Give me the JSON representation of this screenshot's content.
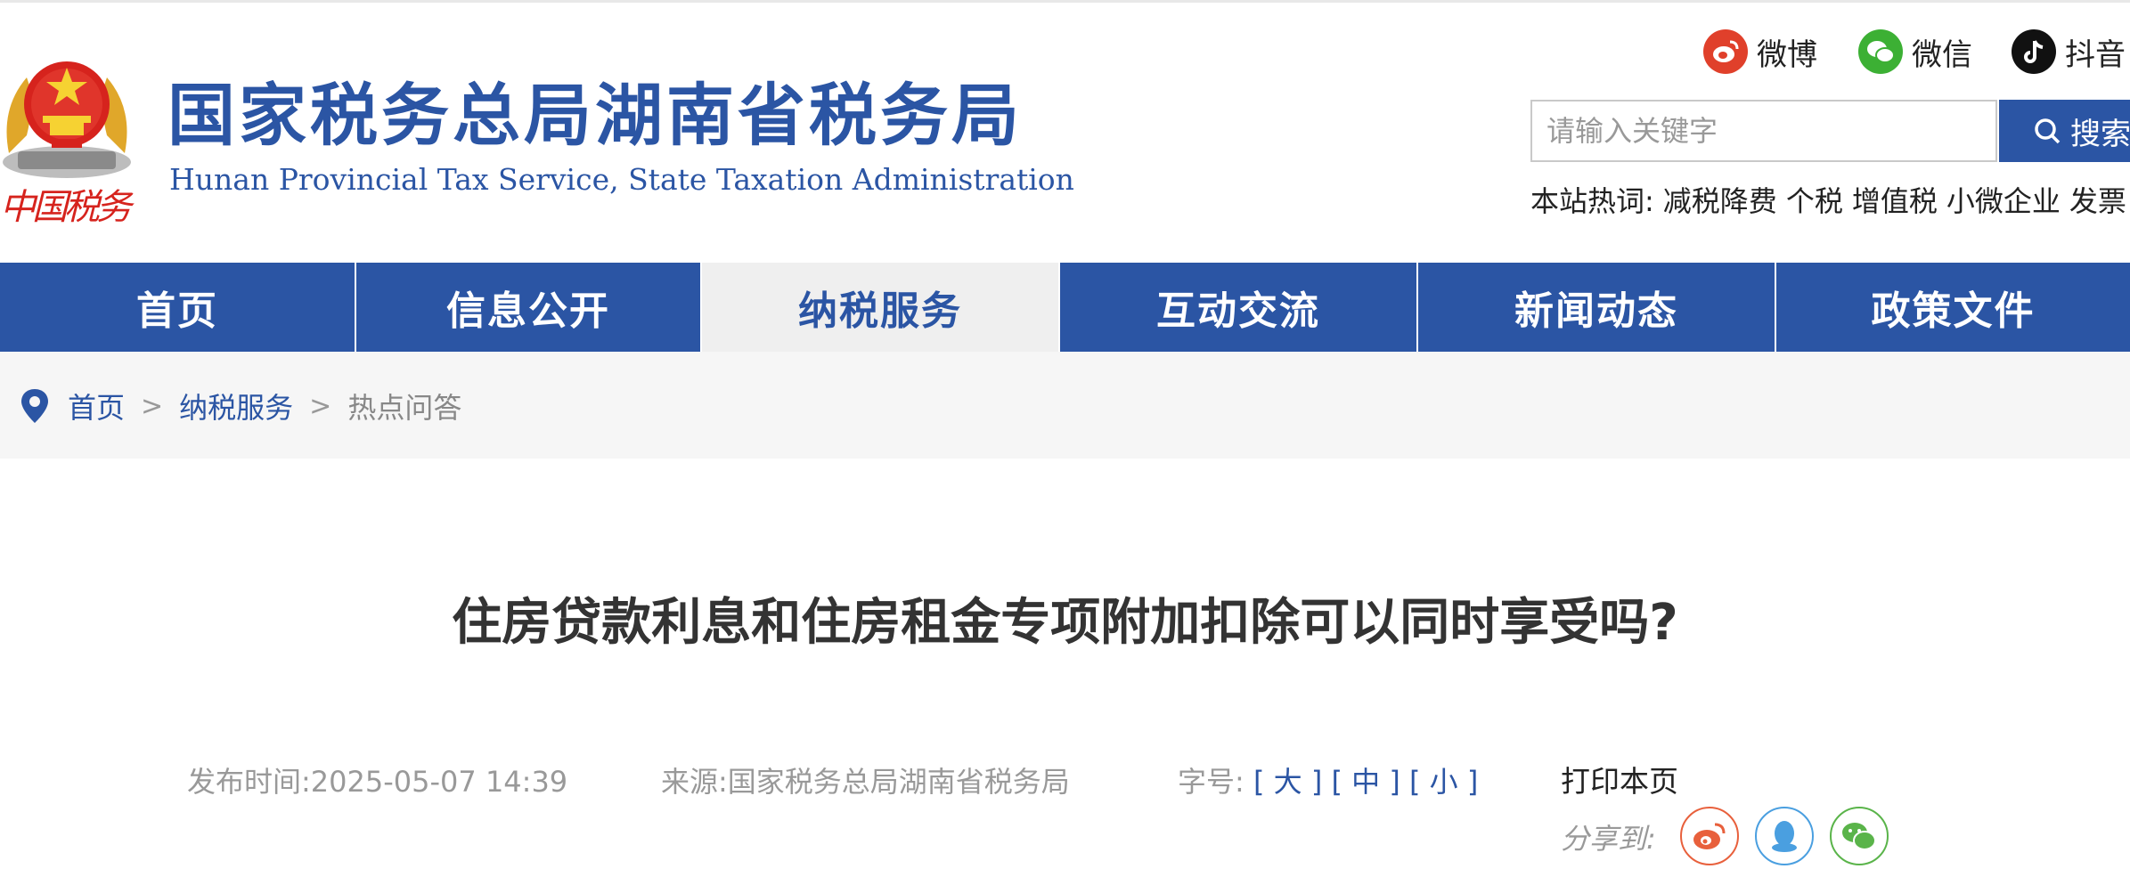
{
  "header": {
    "title": "国家税务总局湖南省税务局",
    "subtitle": "Hunan Provincial  Tax Service,  State Taxation Administration",
    "seal_text": "中国税务"
  },
  "social": [
    {
      "label": "微博",
      "icon": "weibo-icon",
      "color": "#e0402b"
    },
    {
      "label": "微信",
      "icon": "wechat-icon",
      "color": "#3cb034"
    },
    {
      "label": "抖音",
      "icon": "douyin-icon",
      "color": "#111111"
    }
  ],
  "search": {
    "placeholder": "请输入关键字",
    "button": "搜索"
  },
  "hot": {
    "label": "本站热词:",
    "items": [
      "减税降费",
      "个税",
      "增值税",
      "小微企业",
      "发票"
    ]
  },
  "nav": [
    {
      "label": "首页",
      "active": false
    },
    {
      "label": "信息公开",
      "active": false
    },
    {
      "label": "纳税服务",
      "active": true
    },
    {
      "label": "互动交流",
      "active": false
    },
    {
      "label": "新闻动态",
      "active": false
    },
    {
      "label": "政策文件",
      "active": false
    }
  ],
  "breadcrumb": [
    "首页",
    "纳税服务",
    "热点问答"
  ],
  "article": {
    "title": "住房贷款利息和住房租金专项附加扣除可以同时享受吗?",
    "date_label": "发布时间:",
    "date": "2025-05-07 14:39",
    "source_label": "来源:",
    "source": "国家税务总局湖南省税务局",
    "font_label": "字号:",
    "font_sizes": [
      "大",
      "中",
      "小"
    ],
    "print": "打印本页",
    "share_label": "分享到:"
  },
  "colors": {
    "brand_blue": "#2b55a4",
    "nav_active_bg": "#efefef",
    "breadcrumb_bg": "#f6f6f6"
  }
}
